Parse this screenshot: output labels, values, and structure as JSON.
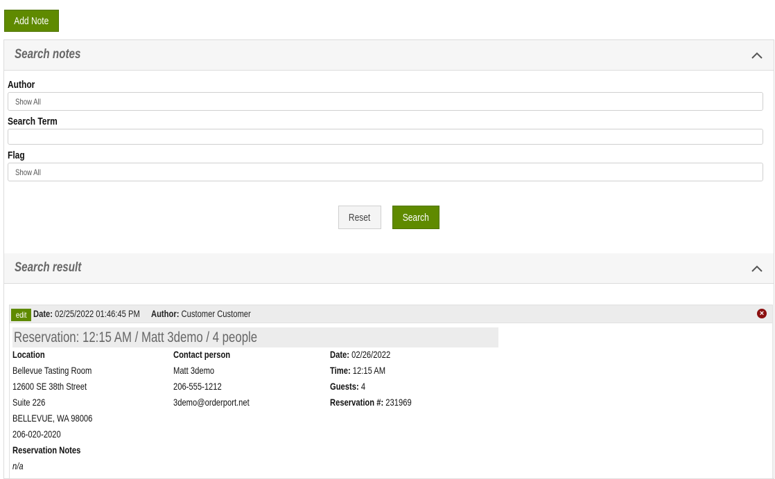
{
  "add_note_label": "Add Note",
  "search_panel": {
    "title": "Search notes",
    "author_label": "Author",
    "author_value": "Show All",
    "search_term_label": "Search Term",
    "search_term_value": "",
    "flag_label": "Flag",
    "flag_value": "Show All",
    "reset_label": "Reset",
    "search_label": "Search"
  },
  "result_panel": {
    "title": "Search result",
    "note": {
      "edit_label": "edit",
      "date_label": "Date:",
      "date_value": "02/25/2022 01:46:45 PM",
      "author_label": "Author:",
      "author_value": "Customer Customer",
      "close_icon": "close-circle-icon",
      "reservation_title": "Reservation: 12:15 AM / Matt 3demo / 4 people",
      "location": {
        "label": "Location",
        "lines": [
          "Bellevue Tasting Room",
          "12600 SE 38th Street",
          "Suite 226",
          "BELLEVUE, WA 98006",
          "206-020-2020"
        ]
      },
      "notes_label": "Reservation Notes",
      "notes_value": "n/a",
      "contact": {
        "label": "Contact person",
        "lines": [
          "Matt 3demo",
          "206-555-1212",
          "3demo@orderport.net"
        ]
      },
      "details": {
        "date_label": "Date:",
        "date_value": "02/26/2022",
        "time_label": "Time:",
        "time_value": "12:15 AM",
        "guests_label": "Guests:",
        "guests_value": "4",
        "res_no_label": "Reservation #:",
        "res_no_value": "231969"
      }
    }
  },
  "colors": {
    "accent": "#5f8a00",
    "close": "#8b1010",
    "header_bg": "#f6f6f6"
  }
}
